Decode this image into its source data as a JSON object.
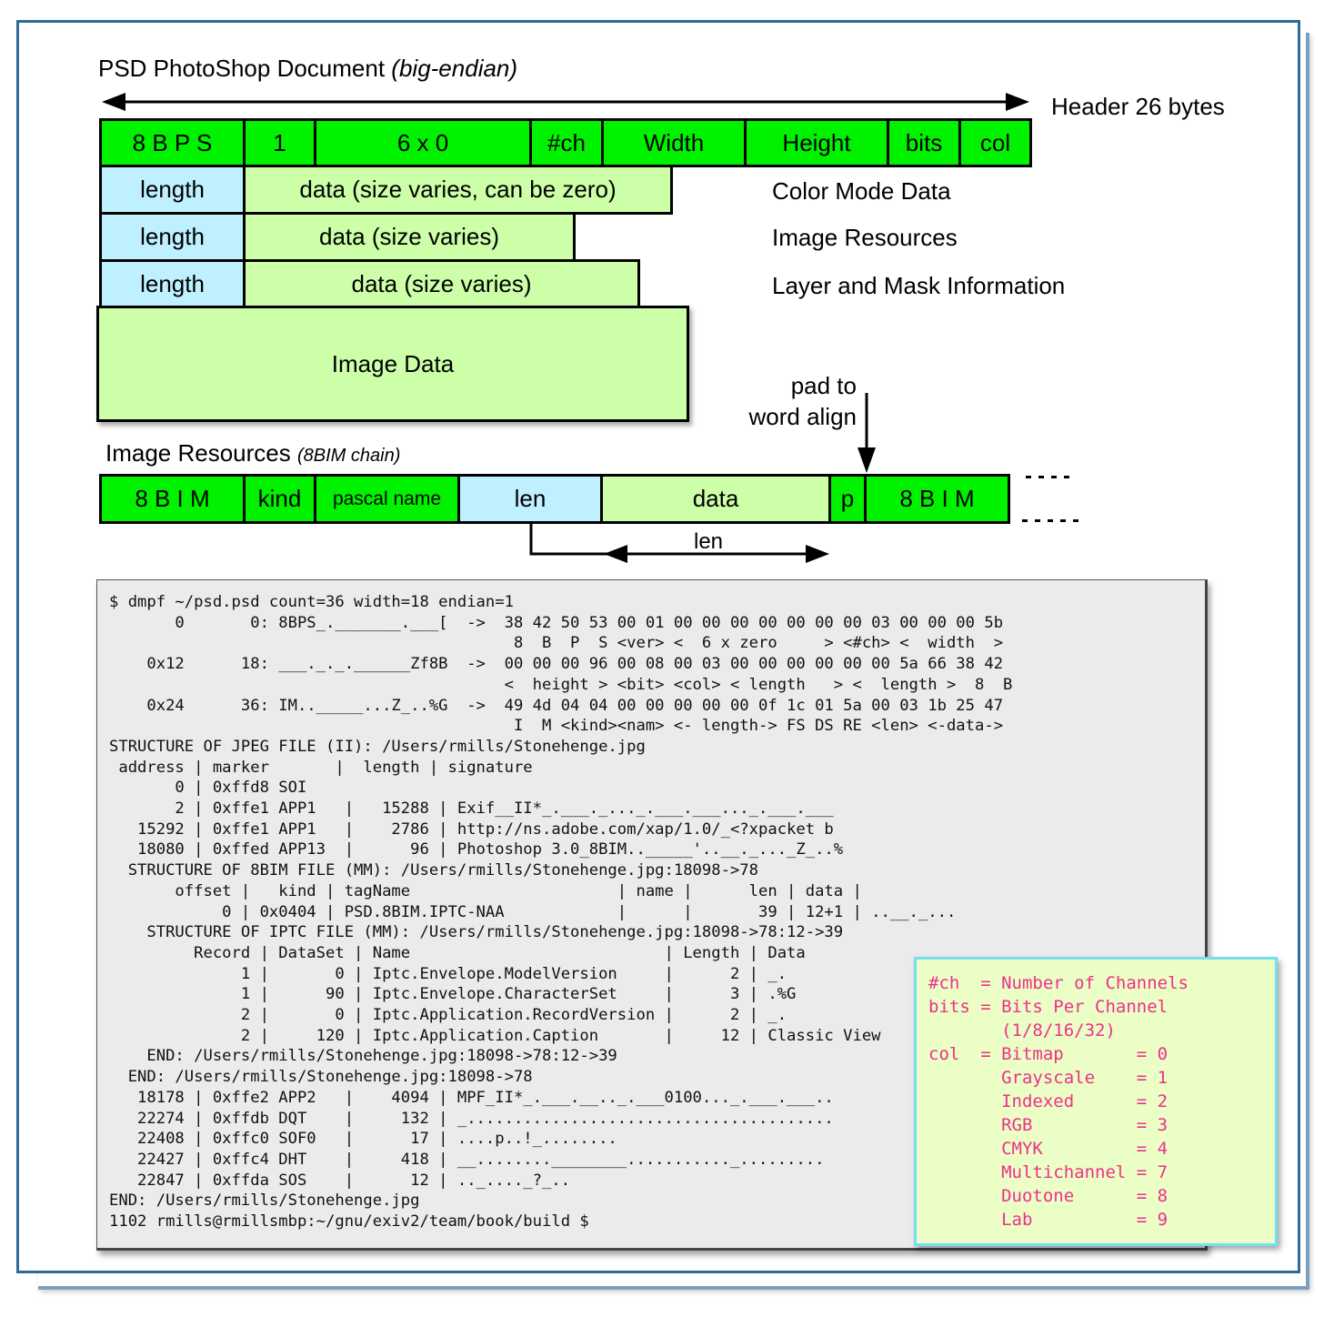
{
  "colors": {
    "field_green": "#00f200",
    "data_green": "#ccffa8",
    "length_blue": "#bff0ff",
    "frame_blue": "#2e6a94",
    "terminal_bg": "#ebebeb",
    "legend_bg": "#eafec6",
    "legend_border": "#76ddf5",
    "legend_text": "#f0308a"
  },
  "psd": {
    "title": "PSD PhotoShop Document ",
    "title_italic": "(big-endian)",
    "header_label": "Header 26 bytes",
    "header_fields": [
      "8 B P S",
      "1",
      "6 x 0",
      "#ch",
      "Width",
      "Height",
      "bits",
      "col"
    ],
    "sections": [
      {
        "length": "length",
        "data": "data (size varies, can be zero)",
        "label": "Color Mode Data"
      },
      {
        "length": "length",
        "data": "data (size varies)",
        "label": "Image Resources"
      },
      {
        "length": "length",
        "data": "data (size varies)",
        "label": "Layer and Mask Information"
      }
    ],
    "image_data": "Image Data"
  },
  "resources": {
    "title": "Image Resources ",
    "title_italic": "(8BIM chain)",
    "pad_note_line1": "pad  to",
    "pad_note_line2": "word align",
    "fields": [
      "8 B I M",
      "kind",
      "pascal name",
      "len",
      "data",
      "p",
      "8 B I M"
    ],
    "len_arrow_label": "len",
    "continuation": ". . . ."
  },
  "terminal": {
    "lines": [
      "$ dmpf ~/psd.psd count=36 width=18 endian=1",
      "       0       0: 8BPS_._______.___[  ->  38 42 50 53 00 01 00 00 00 00 00 00 00 03 00 00 00 5b",
      "                                           8  B  P  S <ver> <  6 x zero     > <#ch> <  width  >",
      "    0x12      18: ___._._.______Zf8B  ->  00 00 00 96 00 08 00 03 00 00 00 00 00 00 5a 66 38 42",
      "                                          <  height > <bit> <col> < length   > <  length >  8  B",
      "    0x24      36: IM.._____...Z_..%G  ->  49 4d 04 04 00 00 00 00 00 0f 1c 01 5a 00 03 1b 25 47",
      "                                           I  M <kind><nam> <- length-> FS DS RE <len> <-data->",
      "STRUCTURE OF JPEG FILE (II): /Users/rmills/Stonehenge.jpg",
      " address | marker       |  length | signature",
      "       0 | 0xffd8 SOI",
      "       2 | 0xffe1 APP1   |   15288 | Exif__II*_.___._..._.___.___..._.___.___",
      "   15292 | 0xffe1 APP1   |    2786 | http://ns.adobe.com/xap/1.0/_<?xpacket b",
      "   18080 | 0xffed APP13  |      96 | Photoshop 3.0_8BIM.._____'..__._..._Z_..%",
      "  STRUCTURE OF 8BIM FILE (MM): /Users/rmills/Stonehenge.jpg:18098->78",
      "       offset |   kind | tagName                      | name |      len | data |",
      "            0 | 0x0404 | PSD.8BIM.IPTC-NAA            |      |       39 | 12+1 | ..__._...",
      "    STRUCTURE OF IPTC FILE (MM): /Users/rmills/Stonehenge.jpg:18098->78:12->39",
      "         Record | DataSet | Name                           | Length | Data",
      "              1 |       0 | Iptc.Envelope.ModelVersion     |      2 | _.",
      "              1 |      90 | Iptc.Envelope.CharacterSet     |      3 | .%G",
      "              2 |       0 | Iptc.Application.RecordVersion |      2 | _.",
      "              2 |     120 | Iptc.Application.Caption       |     12 | Classic View",
      "    END: /Users/rmills/Stonehenge.jpg:18098->78:12->39",
      "  END: /Users/rmills/Stonehenge.jpg:18098->78",
      "   18178 | 0xffe2 APP2   |    4094 | MPF_II*_.___.__.._.___0100..._.___.___..",
      "   22274 | 0xffdb DQT    |     132 | _.......................................",
      "   22408 | 0xffc0 SOF0   |      17 | ....p..!_........",
      "   22427 | 0xffc4 DHT    |     418 | __........________..........._.........",
      "   22847 | 0xffda SOS    |      12 | .._...._?_..",
      "END: /Users/rmills/Stonehenge.jpg",
      "1102 rmills@rmillsmbp:~/gnu/exiv2/team/book/build $"
    ]
  },
  "legend": {
    "lines": [
      "#ch  = Number of Channels",
      "bits = Bits Per Channel",
      "       (1/8/16/32)",
      "col  = Bitmap       = 0",
      "       Grayscale    = 1",
      "       Indexed      = 2",
      "       RGB          = 3",
      "       CMYK         = 4",
      "       Multichannel = 7",
      "       Duotone      = 8",
      "       Lab          = 9"
    ]
  }
}
